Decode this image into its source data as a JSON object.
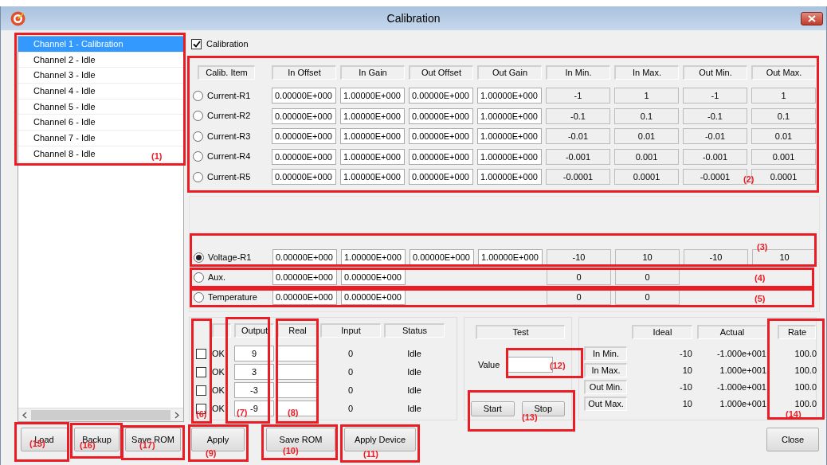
{
  "window": {
    "title": "Calibration"
  },
  "channels": [
    {
      "label": "Channel 1 - Calibration",
      "selected": true
    },
    {
      "label": "Channel 2 - Idle",
      "selected": false
    },
    {
      "label": "Channel 3 - Idle",
      "selected": false
    },
    {
      "label": "Channel 4 - Idle",
      "selected": false
    },
    {
      "label": "Channel 5 - Idle",
      "selected": false
    },
    {
      "label": "Channel 6 - Idle",
      "selected": false
    },
    {
      "label": "Channel 7 - Idle",
      "selected": false
    },
    {
      "label": "Channel 8 - Idle",
      "selected": false
    }
  ],
  "calibration_checkbox": {
    "label": "Calibration",
    "checked": true
  },
  "calib_table": {
    "columns": [
      "Calib. Item",
      "In Offset",
      "In Gain",
      "Out Offset",
      "Out Gain",
      "In Min.",
      "In Max.",
      "Out Min.",
      "Out Max."
    ],
    "rows": [
      {
        "label": "Current-R1",
        "selected": false,
        "in_offset": "0.00000E+000",
        "in_gain": "1.00000E+000",
        "out_offset": "0.00000E+000",
        "out_gain": "1.00000E+000",
        "in_min": "-1",
        "in_max": "1",
        "out_min": "-1",
        "out_max": "1"
      },
      {
        "label": "Current-R2",
        "selected": false,
        "in_offset": "0.00000E+000",
        "in_gain": "1.00000E+000",
        "out_offset": "0.00000E+000",
        "out_gain": "1.00000E+000",
        "in_min": "-0.1",
        "in_max": "0.1",
        "out_min": "-0.1",
        "out_max": "0.1"
      },
      {
        "label": "Current-R3",
        "selected": false,
        "in_offset": "0.00000E+000",
        "in_gain": "1.00000E+000",
        "out_offset": "0.00000E+000",
        "out_gain": "1.00000E+000",
        "in_min": "-0.01",
        "in_max": "0.01",
        "out_min": "-0.01",
        "out_max": "0.01"
      },
      {
        "label": "Current-R4",
        "selected": false,
        "in_offset": "0.00000E+000",
        "in_gain": "1.00000E+000",
        "out_offset": "0.00000E+000",
        "out_gain": "1.00000E+000",
        "in_min": "-0.001",
        "in_max": "0.001",
        "out_min": "-0.001",
        "out_max": "0.001"
      },
      {
        "label": "Current-R5",
        "selected": false,
        "in_offset": "0.00000E+000",
        "in_gain": "1.00000E+000",
        "out_offset": "0.00000E+000",
        "out_gain": "1.00000E+000",
        "in_min": "-0.0001",
        "in_max": "0.0001",
        "out_min": "-0.0001",
        "out_max": "0.0001"
      }
    ],
    "other_rows": [
      {
        "label": "Voltage-R1",
        "selected": true,
        "in_offset": "0.00000E+000",
        "in_gain": "1.00000E+000",
        "out_offset": "0.00000E+000",
        "out_gain": "1.00000E+000",
        "in_min": "-10",
        "in_max": "10",
        "out_min": "-10",
        "out_max": "10"
      },
      {
        "label": "Aux.",
        "selected": false,
        "in_offset": "0.00000E+000",
        "in_gain": "0.00000E+000",
        "in_min": "0",
        "in_max": "0"
      },
      {
        "label": "Temperature",
        "selected": false,
        "in_offset": "0.00000E+000",
        "in_gain": "0.00000E+000",
        "in_min": "0",
        "in_max": "0"
      }
    ]
  },
  "output_panel": {
    "columns": [
      "Output",
      "Real",
      "Input",
      "Status"
    ],
    "rows": [
      {
        "checked": false,
        "ok": "OK",
        "output": "9",
        "input": "0",
        "status": "Idle"
      },
      {
        "checked": false,
        "ok": "OK",
        "output": "3",
        "input": "0",
        "status": "Idle"
      },
      {
        "checked": false,
        "ok": "OK",
        "output": "-3",
        "input": "0",
        "status": "Idle"
      },
      {
        "checked": false,
        "ok": "OK",
        "output": "-9",
        "input": "0",
        "status": "Idle"
      }
    ]
  },
  "test_panel": {
    "title": "Test",
    "value_label": "Value",
    "buttons": [
      "Start",
      "Stop"
    ]
  },
  "stats_panel": {
    "columns": [
      "Ideal",
      "Actual",
      "Rate"
    ],
    "rows": [
      {
        "label": "In Min.",
        "ideal": "-10",
        "actual": "-1.000e+001",
        "rate": "100.0"
      },
      {
        "label": "In Max.",
        "ideal": "10",
        "actual": "1.000e+001",
        "rate": "100.0"
      },
      {
        "label": "Out Min.",
        "ideal": "-10",
        "actual": "-1.000e+001",
        "rate": "100.0"
      },
      {
        "label": "Out Max.",
        "ideal": "10",
        "actual": "1.000e+001",
        "rate": "100.0"
      }
    ]
  },
  "left_buttons": [
    "Load",
    "Backup",
    "Save ROM"
  ],
  "action_buttons": [
    "Apply",
    "Save ROM",
    "Apply Device"
  ],
  "close_button": "Close",
  "annotations": [
    {
      "label": "(1)"
    },
    {
      "label": "(2)"
    },
    {
      "label": "(3)"
    },
    {
      "label": "(4)"
    },
    {
      "label": "(5)"
    },
    {
      "label": "(6)"
    },
    {
      "label": "(7)"
    },
    {
      "label": "(8)"
    },
    {
      "label": "(9)"
    },
    {
      "label": "(10)"
    },
    {
      "label": "(11)"
    },
    {
      "label": "(12)"
    },
    {
      "label": "(13)"
    },
    {
      "label": "(14)"
    },
    {
      "label": "(15)"
    },
    {
      "label": "(16)"
    },
    {
      "label": "(17)"
    }
  ]
}
